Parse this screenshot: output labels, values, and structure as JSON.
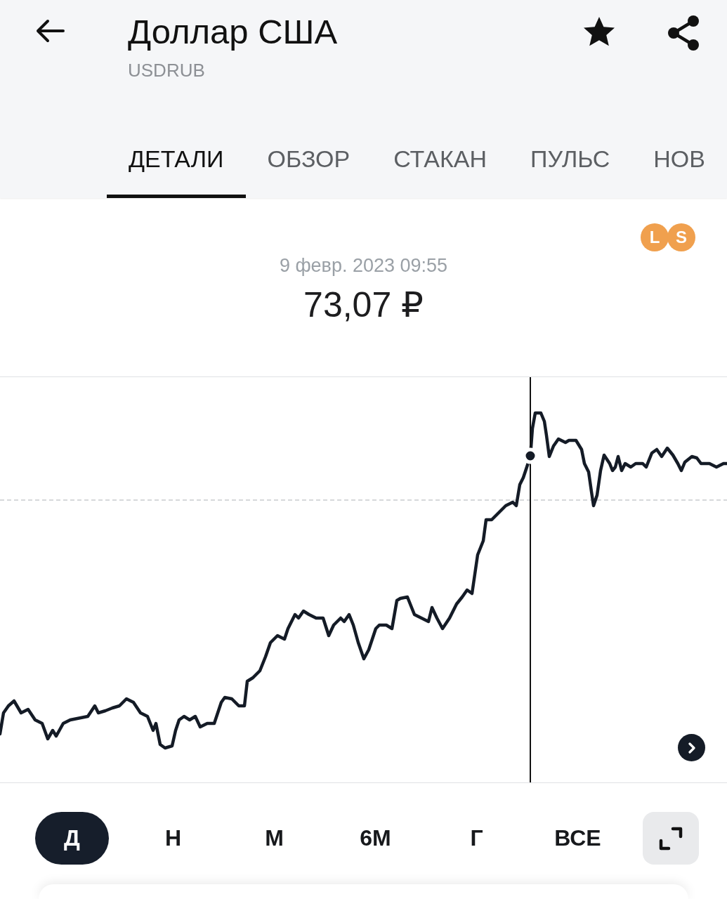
{
  "header": {
    "title": "Доллар США",
    "ticker": "USDRUB",
    "favorite": true
  },
  "tabs": [
    {
      "label": "ДЕТАЛИ",
      "selected": true
    },
    {
      "label": "ОБЗОР",
      "selected": false
    },
    {
      "label": "СТАКАН",
      "selected": false
    },
    {
      "label": "ПУЛЬС",
      "selected": false
    },
    {
      "label": "НОВ",
      "selected": false
    }
  ],
  "badges": [
    {
      "label": "L"
    },
    {
      "label": "S"
    }
  ],
  "quote": {
    "date": "9 февр. 2023 09:55",
    "price": "73,07 ₽"
  },
  "periods": [
    {
      "label": "Д",
      "selected": true
    },
    {
      "label": "Н",
      "selected": false
    },
    {
      "label": "М",
      "selected": false
    },
    {
      "label": "6М",
      "selected": false
    },
    {
      "label": "Г",
      "selected": false
    },
    {
      "label": "ВСЕ",
      "selected": false
    }
  ]
}
